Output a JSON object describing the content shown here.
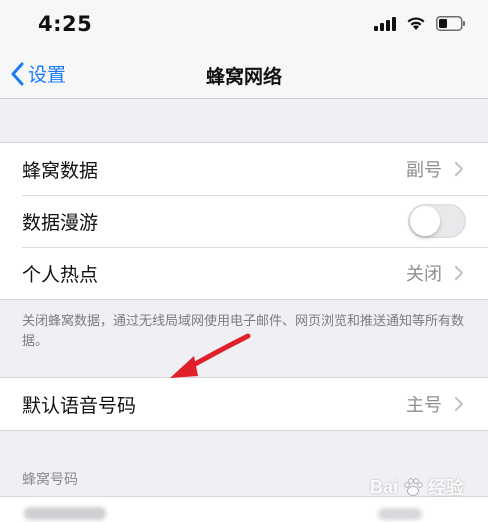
{
  "status_bar": {
    "time": "4:25"
  },
  "nav": {
    "back_label": "设置",
    "title": "蜂窝网络"
  },
  "cellular_group": {
    "rows": [
      {
        "label": "蜂窝数据",
        "value": "副号",
        "kind": "chevron"
      },
      {
        "label": "数据漫游",
        "value": "",
        "kind": "toggle",
        "toggle_on": false
      },
      {
        "label": "个人热点",
        "value": "关闭",
        "kind": "chevron"
      }
    ]
  },
  "footnote": "关闭蜂窝数据，通过无线局域网使用电子邮件、网页浏览和推送通知等所有数据。",
  "voice_group": {
    "rows": [
      {
        "label": "默认语音号码",
        "value": "主号",
        "kind": "chevron"
      }
    ]
  },
  "section_header": "蜂窝号码",
  "watermark": {
    "text": "Bai",
    "suffix": "经验"
  },
  "colors": {
    "accent": "#1a7cf5",
    "arrow": "#e0202a",
    "secondary_text": "#8e8e93",
    "background": "#efeff4"
  }
}
